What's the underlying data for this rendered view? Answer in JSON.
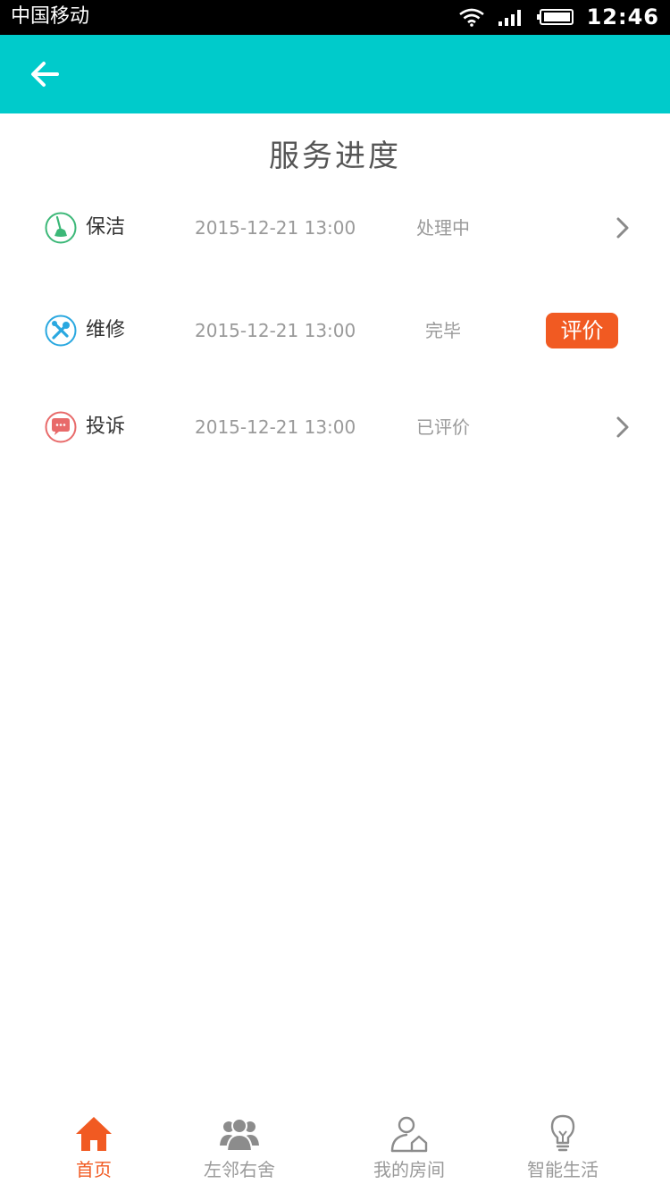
{
  "status_bar": {
    "carrier": "中国移动",
    "time": "12:46"
  },
  "header": {
    "back_icon": "arrow-left-icon"
  },
  "page": {
    "title": "服务进度"
  },
  "rows": [
    {
      "icon": "broom-icon",
      "icon_color": "#3cb878",
      "name": "保洁",
      "time": "2015-12-21 13:00",
      "status": "处理中",
      "action": "chevron"
    },
    {
      "icon": "wrench-icon",
      "icon_color": "#2aa8e0",
      "name": "维修",
      "time": "2015-12-21 13:00",
      "status": "完毕",
      "action": "button",
      "action_label": "评价"
    },
    {
      "icon": "chat-icon",
      "icon_color": "#e86a6a",
      "name": "投诉",
      "time": "2015-12-21 13:00",
      "status": "已评价",
      "action": "chevron"
    }
  ],
  "tabs": [
    {
      "label": "首页",
      "icon": "home-icon",
      "active": true
    },
    {
      "label": "左邻右舍",
      "icon": "neighbors-icon",
      "active": false
    },
    {
      "label": "我的房间",
      "icon": "my-room-icon",
      "active": false
    },
    {
      "label": "智能生活",
      "icon": "lightbulb-icon",
      "active": false
    }
  ],
  "colors": {
    "header_bg": "#00cbcb",
    "accent": "#f15a22",
    "muted_text": "#9a9a9a"
  }
}
